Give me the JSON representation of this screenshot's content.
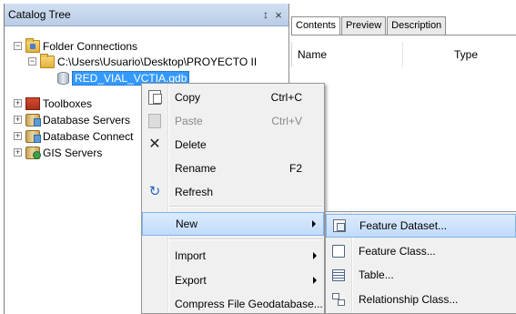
{
  "catalog": {
    "title": "Catalog Tree",
    "pin_glyph": "&#x1F4CC;",
    "pin_text": "\u0004",
    "close_text": "×",
    "items": [
      {
        "label": "Folder Connections",
        "expander": "−"
      },
      {
        "label": "C:\\Users\\Usuario\\Desktop\\PROYECTO II",
        "expander": "−"
      },
      {
        "label": "RED_VIAL_VCTIA.gdb"
      },
      {
        "label": "Toolboxes",
        "expander": "+"
      },
      {
        "label": "Database Servers",
        "expander": "+"
      },
      {
        "label": "Database Connect",
        "expander": "+"
      },
      {
        "label": "GIS Servers",
        "expander": "+"
      }
    ]
  },
  "right_panel": {
    "tabs": [
      "Contents",
      "Preview",
      "Description"
    ],
    "columns": {
      "name": "Name",
      "type": "Type"
    }
  },
  "context_menu": {
    "items": [
      {
        "label": "Copy",
        "shortcut": "Ctrl+C",
        "icon": "copy-icon"
      },
      {
        "label": "Paste",
        "shortcut": "Ctrl+V",
        "icon": "paste-icon",
        "disabled": true
      },
      {
        "label": "Delete",
        "shortcut": "",
        "icon": "delete-icon"
      },
      {
        "label": "Rename",
        "shortcut": "F2",
        "icon": ""
      },
      {
        "label": "Refresh",
        "shortcut": "",
        "icon": "refresh-icon"
      },
      {
        "label": "New",
        "shortcut": "",
        "icon": "",
        "highlighted": true,
        "submenu": true
      },
      {
        "label": "Import",
        "shortcut": "",
        "icon": "",
        "submenu": true
      },
      {
        "label": "Export",
        "shortcut": "",
        "icon": "",
        "submenu": true
      },
      {
        "label": "Compress File Geodatabase...",
        "shortcut": "",
        "icon": ""
      }
    ]
  },
  "submenu": {
    "items": [
      {
        "label": "Feature Dataset...",
        "icon": "feature-dataset-icon",
        "highlighted": true
      },
      {
        "label": "Feature Class...",
        "icon": "feature-class-icon"
      },
      {
        "label": "Table...",
        "icon": "table-icon"
      },
      {
        "label": "Relationship Class...",
        "icon": "relationship-class-icon"
      }
    ]
  },
  "colors": {
    "title_bar": "#c6d7ee",
    "selection": "#3399ff",
    "menu_bg": "#f0f0f0",
    "menu_highlight": "#c1dbfc"
  }
}
